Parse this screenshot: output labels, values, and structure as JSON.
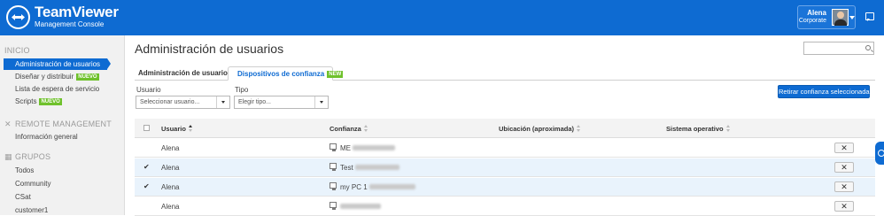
{
  "header": {
    "brand": "TeamViewer",
    "subtitle": "Management Console",
    "user_name": "Alena",
    "user_role": "Corporate"
  },
  "sidebar": {
    "section_inicio": "INICIO",
    "items_inicio": [
      {
        "label": "Administración de usuarios",
        "active": true
      },
      {
        "label": "Diseñar y distribuir",
        "badge": "NUEVO"
      },
      {
        "label": "Lista de espera de servicio"
      },
      {
        "label": "Scripts",
        "badge": "NUEVO"
      }
    ],
    "section_remote": "REMOTE MANAGEMENT",
    "items_remote": [
      {
        "label": "Información general"
      }
    ],
    "section_grupos": "GRUPOS",
    "items_grupos": [
      {
        "label": "Todos"
      },
      {
        "label": "Community"
      },
      {
        "label": "CSat"
      },
      {
        "label": "customer1"
      }
    ]
  },
  "main": {
    "title": "Administración de usuarios",
    "search_placeholder": ""
  },
  "tabs": [
    {
      "label": "Administración de usuarios"
    },
    {
      "label": "Dispositivos de confianza",
      "badge": "NEW"
    }
  ],
  "filters": {
    "user_label": "Usuario",
    "user_value": "Seleccionar usuario...",
    "type_label": "Tipo",
    "type_value": "Elegir tipo..."
  },
  "actions": {
    "revoke": "Retirar confianza seleccionada"
  },
  "table": {
    "headers": [
      "Usuario",
      "Confianza",
      "Ubicación (aproximada)",
      "Sistema operativo"
    ],
    "rows": [
      {
        "user": "Alena",
        "device": "ME",
        "checked": false
      },
      {
        "user": "Alena",
        "device": "Test",
        "checked": true
      },
      {
        "user": "Alena",
        "device": "my PC 1",
        "checked": true
      },
      {
        "user": "Alena",
        "device": "",
        "checked": false
      }
    ],
    "delete_glyph": "✕",
    "check_glyph": "✔"
  },
  "colors": {
    "accent": "#0e6bd2",
    "badge": "#6fc12c",
    "selected_row": "#e9f3fc"
  }
}
